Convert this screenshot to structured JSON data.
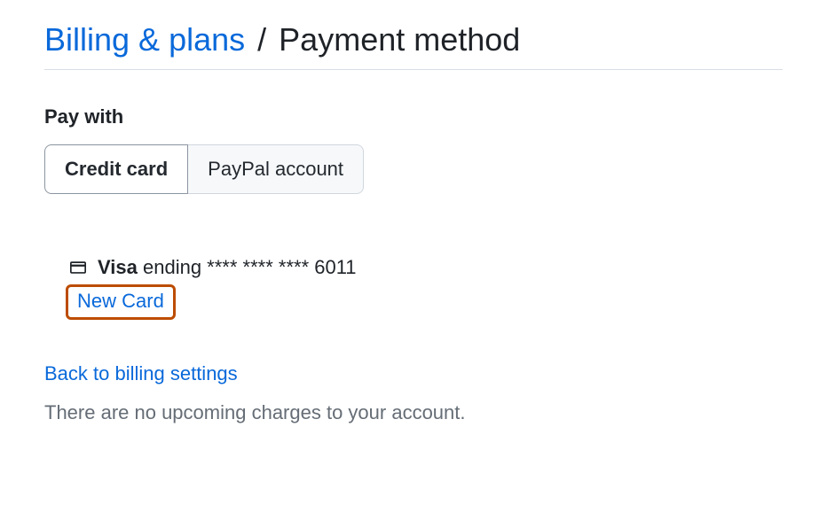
{
  "breadcrumb": {
    "parent": "Billing & plans",
    "separator": "/",
    "current": "Payment method"
  },
  "section": {
    "heading": "Pay with"
  },
  "tabs": {
    "credit_card": "Credit card",
    "paypal": "PayPal account"
  },
  "card": {
    "brand": "Visa",
    "ending_text": "ending **** **** **** 6011"
  },
  "actions": {
    "new_card": "New Card",
    "back_link": "Back to billing settings"
  },
  "note": "There are no upcoming charges to your account."
}
